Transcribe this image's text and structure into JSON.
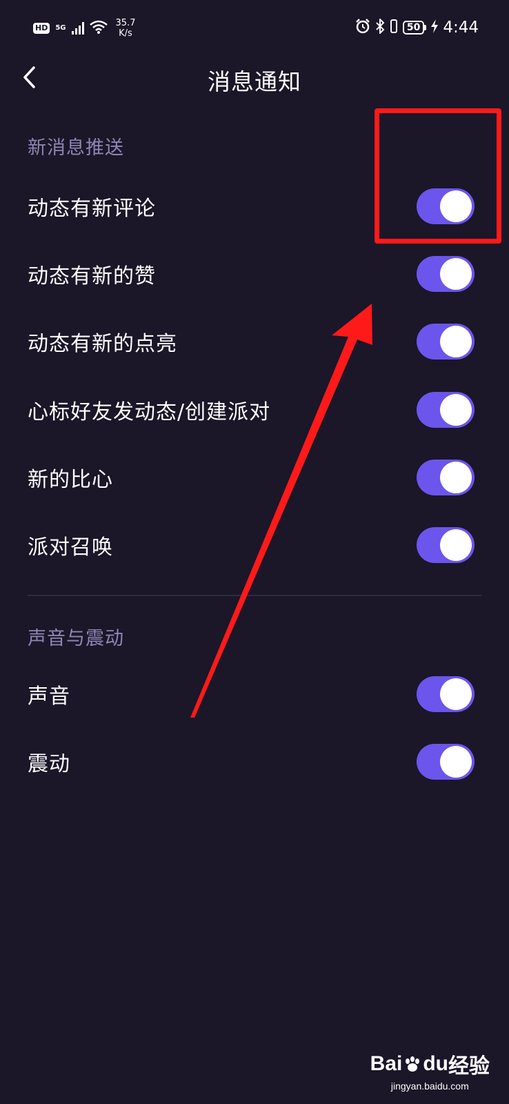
{
  "status_bar": {
    "hd_label": "HD",
    "network_label": "5G",
    "speed_value": "35.7",
    "speed_unit": "K/s",
    "battery_level": "50",
    "time": "4:44",
    "icons": [
      "alarm-icon",
      "bluetooth-icon",
      "vibrate-icon",
      "charging-icon",
      "wifi-icon",
      "signal-icon"
    ]
  },
  "header": {
    "title": "消息通知",
    "back_icon": "chevron-left-icon"
  },
  "sections": {
    "push": {
      "title": "新消息推送",
      "items": [
        {
          "label": "动态有新评论",
          "enabled": true
        },
        {
          "label": "动态有新的赞",
          "enabled": true
        },
        {
          "label": "动态有新的点亮",
          "enabled": true
        },
        {
          "label": "心标好友发动态/创建派对",
          "enabled": true
        },
        {
          "label": "新的比心",
          "enabled": true
        },
        {
          "label": "派对召唤",
          "enabled": true
        }
      ]
    },
    "sound": {
      "title": "声音与震动",
      "items": [
        {
          "label": "声音",
          "enabled": true
        },
        {
          "label": "震动",
          "enabled": true
        }
      ]
    }
  },
  "colors": {
    "background": "#1b1628",
    "toggle_on": "#6c55ec",
    "section_title": "#8f87b3",
    "annotation": "#ff1a1a"
  },
  "watermark": {
    "brand_left": "Bai",
    "brand_mid": "du",
    "brand_right": "经验",
    "site": "jingyan.baidu.com"
  }
}
